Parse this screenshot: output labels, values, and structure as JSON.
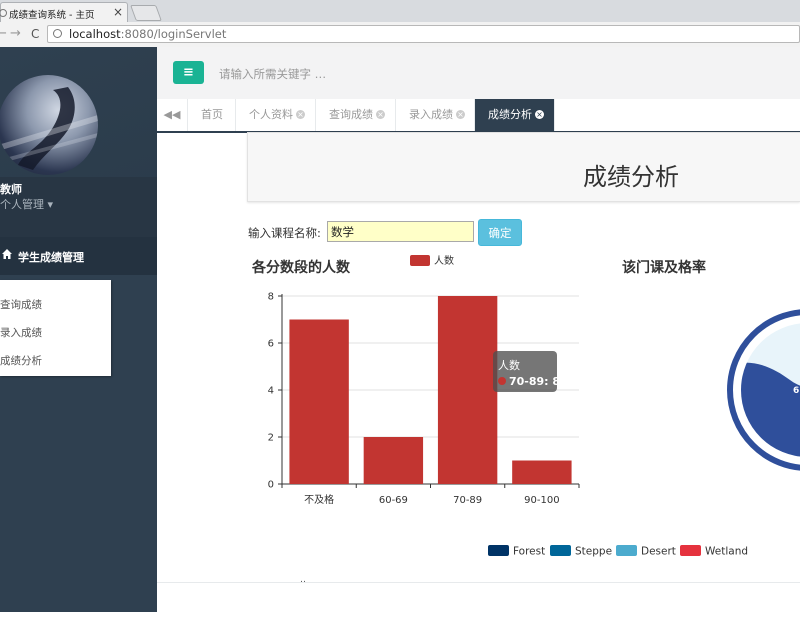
{
  "browser": {
    "tab_title": "成绩查询系统 - 主页",
    "tab_close": "×",
    "url_host": "localhost",
    "url_rest": ":8080/loginServlet",
    "back": "←",
    "forward": "→",
    "reload": "C"
  },
  "sidebar": {
    "role": "教师",
    "profile_menu": "个人管理 ▾",
    "nav_icon": "home-icon",
    "nav_header": "学生成绩管理",
    "items": [
      {
        "label": "查询成绩"
      },
      {
        "label": "录入成绩"
      },
      {
        "label": "成绩分析"
      }
    ]
  },
  "header": {
    "menu_button": "≡",
    "search_placeholder": "请输入所需关键字 …"
  },
  "tabs": {
    "scroll_left": "◀◀",
    "items": [
      {
        "label": "首页"
      },
      {
        "label": "个人资料",
        "close": "×"
      },
      {
        "label": "查询成绩",
        "close": "×"
      },
      {
        "label": "录入成绩",
        "close": "×"
      },
      {
        "label": "成绩分析",
        "close": "×"
      }
    ]
  },
  "page": {
    "title": "成绩分析",
    "course_label": "输入课程名称:",
    "course_value": "数学",
    "confirm_label": "确定",
    "chart1_title": "各分数段的人数",
    "chart2_title": "该门课及格率",
    "gauge_partial_label": "6",
    "bottom_partial_text": "‥"
  },
  "chart_data": [
    {
      "type": "bar",
      "categories": [
        "不及格",
        "60-69",
        "70-89",
        "90-100"
      ],
      "series": [
        {
          "name": "人数",
          "values": [
            7,
            2,
            8,
            1
          ]
        }
      ],
      "ylim": [
        0,
        8
      ],
      "yticks": [
        "0",
        "2",
        "4",
        "6",
        "8"
      ],
      "grid": true,
      "legend": "top-center",
      "colors": {
        "bar": "#c23531"
      },
      "tooltip": {
        "title": "人数",
        "text": "70-89: 8"
      }
    },
    {
      "type": "gauge",
      "legend": [
        "Forest",
        "Steppe",
        "Desert",
        "Wetland"
      ],
      "legend_colors": [
        "#003366",
        "#006699",
        "#4cabce",
        "#e5323e"
      ]
    }
  ]
}
